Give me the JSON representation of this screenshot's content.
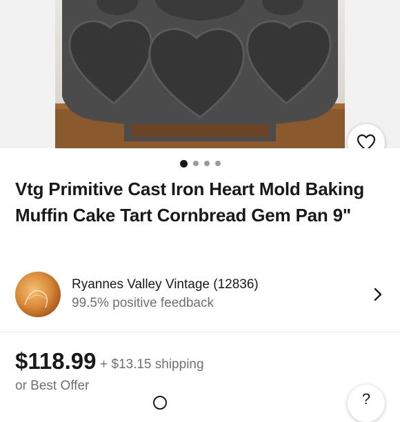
{
  "listing": {
    "title": "Vtg Primitive Cast Iron Heart Mold Baking Muffin Cake Tart Cornbread Gem Pan 9\"",
    "image_count": 4,
    "active_image": 1
  },
  "seller": {
    "name": "Ryannes Valley Vintage (12836)",
    "feedback": "99.5% positive feedback"
  },
  "pricing": {
    "price": "$118.99",
    "shipping": "+ $13.15 shipping",
    "best_offer": "or Best Offer"
  },
  "icons": {
    "watchlist": "heart-outline-icon",
    "seller_chevron": "chevron-right-icon",
    "help": "question-icon"
  },
  "colors": {
    "text_primary": "#191919",
    "text_secondary": "#707070",
    "background": "#ffffff",
    "photo_background": "#f2f2f2",
    "dot_active": "#191919",
    "dot_inactive": "#9a9a9a"
  }
}
